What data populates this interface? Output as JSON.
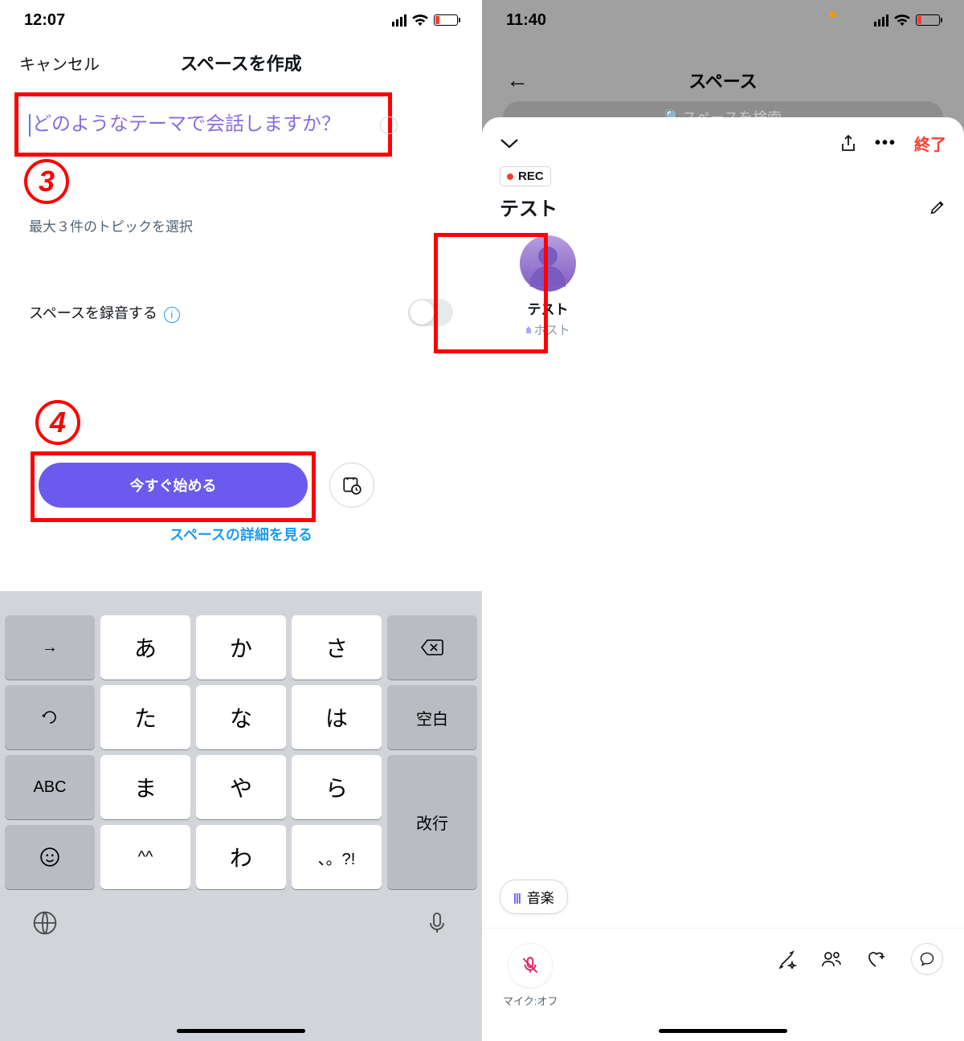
{
  "left": {
    "status": {
      "time": "12:07"
    },
    "header": {
      "cancel": "キャンセル",
      "title": "スペースを作成"
    },
    "theme_placeholder": "どのようなテーマで会話しますか？",
    "topic_select": "最大３件のトピックを選択",
    "record_label": "スペースを録音する",
    "start_button": "今すぐ始める",
    "detail_link": "スペースの詳細を見る",
    "annotations": {
      "step3": "3",
      "step4": "4"
    },
    "keyboard": {
      "rows": [
        [
          "→",
          "あ",
          "か",
          "さ",
          "⌫"
        ],
        [
          "↺",
          "た",
          "な",
          "は",
          "空白"
        ],
        [
          "ABC",
          "ま",
          "や",
          "ら",
          "改行"
        ],
        [
          "☺",
          "^^",
          "わ",
          "、。?!",
          ""
        ]
      ],
      "space_key": "空白",
      "return_key": "改行",
      "abc_key": "ABC"
    }
  },
  "right": {
    "status": {
      "time": "11:40"
    },
    "bg_header": {
      "title": "スペース",
      "search_placeholder": "スペースを検索"
    },
    "sheet": {
      "end": "終了",
      "rec": "REC",
      "title": "テスト",
      "participant": {
        "name": "テスト",
        "role": "ホスト"
      },
      "music": "音楽",
      "mic_label": "マイク:オフ"
    }
  }
}
